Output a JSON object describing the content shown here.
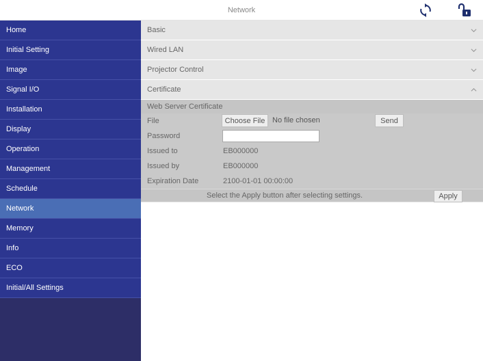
{
  "header": {
    "title": "Network",
    "refresh_icon": "refresh-icon",
    "lock_icon": "unlock-icon"
  },
  "sidebar": {
    "items": [
      {
        "label": "Home"
      },
      {
        "label": "Initial Setting"
      },
      {
        "label": "Image"
      },
      {
        "label": "Signal I/O"
      },
      {
        "label": "Installation"
      },
      {
        "label": "Display"
      },
      {
        "label": "Operation"
      },
      {
        "label": "Management"
      },
      {
        "label": "Schedule"
      },
      {
        "label": "Network",
        "active": true
      },
      {
        "label": "Memory"
      },
      {
        "label": "Info"
      },
      {
        "label": "ECO"
      },
      {
        "label": "Initial/All Settings"
      }
    ]
  },
  "sections": {
    "basic": "Basic",
    "wired_lan": "Wired LAN",
    "projector_control": "Projector Control",
    "certificate": "Certificate"
  },
  "certificate": {
    "heading": "Web Server Certificate",
    "file_label": "File",
    "choose_file": "Choose File",
    "no_file": "No file chosen",
    "send": "Send",
    "password_label": "Password",
    "password_value": "",
    "issued_to_label": "Issued to",
    "issued_to_value": "EB000000",
    "issued_by_label": "Issued by",
    "issued_by_value": "EB000000",
    "expiration_label": "Expiration Date",
    "expiration_value": "2100-01-01 00:00:00"
  },
  "footer": {
    "message": "Select the Apply button after selecting settings.",
    "apply": "Apply"
  },
  "colors": {
    "sidebar_bg": "#2c3690",
    "sidebar_active": "#4a6eb5",
    "accent_icon": "#1e2f6e"
  }
}
